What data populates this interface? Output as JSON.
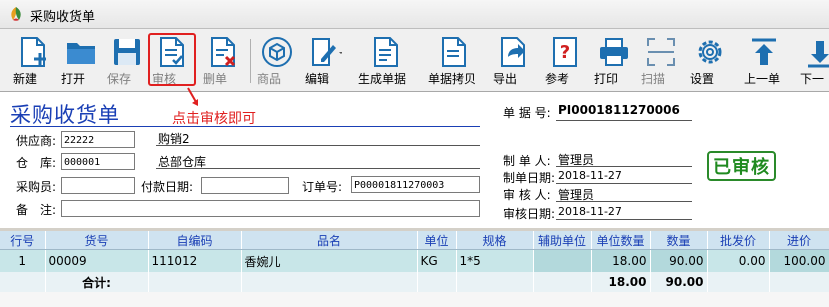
{
  "window": {
    "title": "采购收货单"
  },
  "toolbar": [
    {
      "label": "新建",
      "icon": "new-doc-icon",
      "enabled": true
    },
    {
      "label": "打开",
      "icon": "folder-icon",
      "enabled": true
    },
    {
      "label": "保存",
      "icon": "save-icon",
      "enabled": false
    },
    {
      "label": "审核",
      "icon": "audit-doc-icon",
      "enabled": false
    },
    {
      "label": "删单",
      "icon": "delete-doc-icon",
      "enabled": false
    },
    {
      "label": "商品",
      "icon": "box-icon",
      "enabled": false
    },
    {
      "label": "编辑",
      "icon": "edit-icon",
      "enabled": true
    },
    {
      "label": "生成单据",
      "icon": "generate-doc-icon",
      "enabled": true
    },
    {
      "label": "单据拷贝",
      "icon": "copy-doc-icon",
      "enabled": true
    },
    {
      "label": "导出",
      "icon": "export-icon",
      "enabled": true
    },
    {
      "label": "参考",
      "icon": "reference-icon",
      "enabled": true
    },
    {
      "label": "打印",
      "icon": "printer-icon",
      "enabled": true
    },
    {
      "label": "扫描",
      "icon": "scan-icon",
      "enabled": false
    },
    {
      "label": "设置",
      "icon": "gear-icon",
      "enabled": true
    },
    {
      "label": "上一单",
      "icon": "arrow-up-icon",
      "enabled": true
    },
    {
      "label": "下一",
      "icon": "arrow-down-icon",
      "enabled": true
    }
  ],
  "annotation": "点击审核即可",
  "form": {
    "title": "采购收货单",
    "doc_no_label": "单 据 号:",
    "doc_no": "PI0001811270006",
    "supplier_label": "供应商:",
    "supplier_code": "22222",
    "supplier_name": "购销2",
    "warehouse_label": "仓　库:",
    "warehouse_code": "000001",
    "warehouse_name": "总部仓库",
    "buyer_label": "采购员:",
    "buyer": "",
    "pay_date_label": "付款日期:",
    "pay_date": "",
    "order_no_label": "订单号:",
    "order_no": "P00001811270003",
    "remark_label": "备　注:",
    "remark": "",
    "maker_label": "制 单 人:",
    "maker": "管理员",
    "make_date_label": "制单日期:",
    "make_date": "2018-11-27",
    "auditor_label": "审 核 人:",
    "auditor": "管理员",
    "audit_date_label": "审核日期:",
    "audit_date": "2018-11-27",
    "status_stamp": "已审核",
    "accent_color": "#1a3fb5"
  },
  "grid": {
    "columns": [
      "行号",
      "货号",
      "自编码",
      "品名",
      "单位",
      "规格",
      "辅助单位",
      "单位数量",
      "数量",
      "批发价",
      "进价"
    ],
    "rows": [
      [
        "1",
        "00009",
        "111012",
        "香婉儿",
        "KG",
        "1*5",
        "",
        "18.00",
        "90.00",
        "0.00",
        "100.00"
      ]
    ],
    "total": {
      "label": "合计:",
      "unit_qty": "18.00",
      "qty": "90.00"
    }
  }
}
